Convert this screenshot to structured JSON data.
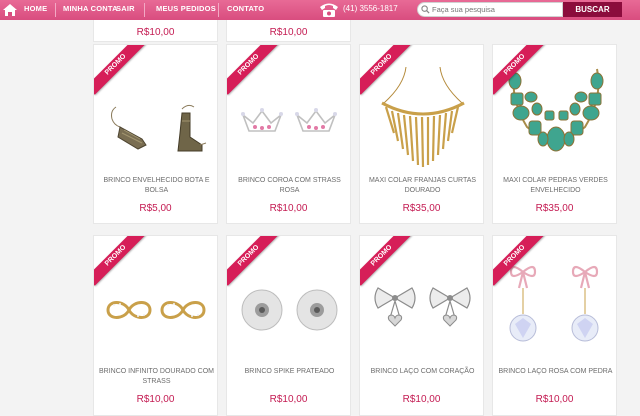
{
  "nav": {
    "home": "HOME",
    "account": "MINHA CONTA",
    "logout": "SAIR",
    "orders": "MEUS PEDIDOS",
    "contact": "CONTATO",
    "phone": "(41) 3556-1817",
    "search_placeholder": "Faça sua pesquisa",
    "search_button": "BUSCAR"
  },
  "promo_label": "PROMO",
  "top_prices": [
    "R$10,00",
    "R$10,00"
  ],
  "rows": [
    [
      {
        "name": "BRINCO ENVELHECIDO BOTA E BOLSA",
        "price": "R$5,00",
        "icon": "boot-earring-icon"
      },
      {
        "name": "BRINCO COROA COM STRASS ROSA",
        "price": "R$10,00",
        "icon": "crown-earring-icon"
      },
      {
        "name": "MAXI COLAR FRANJAS CURTAS DOURADO",
        "price": "R$35,00",
        "icon": "fringe-necklace-icon"
      },
      {
        "name": "MAXI COLAR PEDRAS VERDES ENVELHECIDO",
        "price": "R$35,00",
        "icon": "green-stone-necklace-icon"
      }
    ],
    [
      {
        "name": "BRINCO INFINITO DOURADO COM STRASS",
        "price": "R$10,00",
        "icon": "infinity-earring-icon"
      },
      {
        "name": "BRINCO SPIKE PRATEADO",
        "price": "R$10,00",
        "icon": "spike-earring-icon"
      },
      {
        "name": "BRINCO LAÇO COM CORAÇÃO",
        "price": "R$10,00",
        "icon": "bow-heart-earring-icon"
      },
      {
        "name": "BRINCO LAÇO ROSA COM PEDRA",
        "price": "R$10,00",
        "icon": "pink-bow-earring-icon"
      }
    ]
  ]
}
